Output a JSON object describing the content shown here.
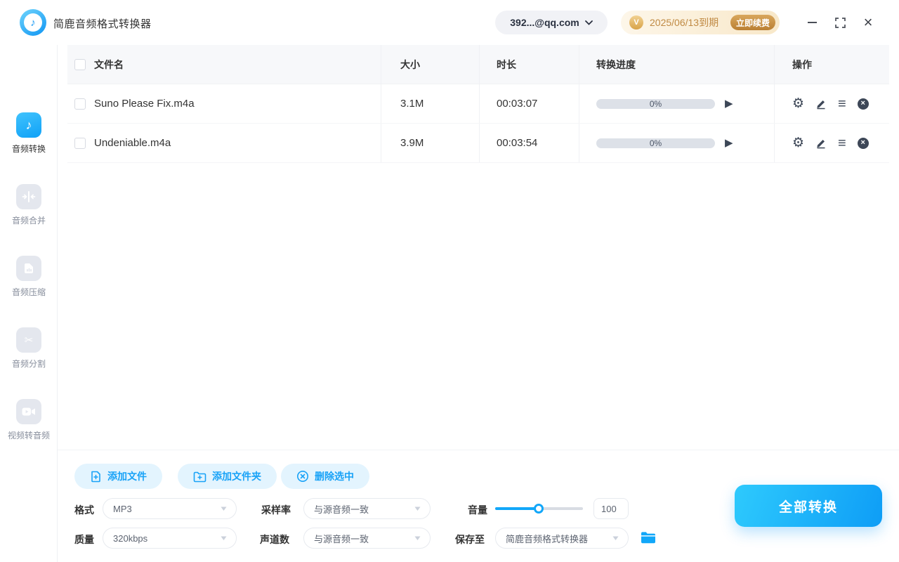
{
  "app_title": "简鹿音频格式转换器",
  "titlebar": {
    "account": "392...@qq.com",
    "vip_badge": "V",
    "vip_expiry": "2025/06/13到期",
    "renew_label": "立即续费"
  },
  "sidebar": {
    "items": [
      {
        "label": "音频转换",
        "active": true
      },
      {
        "label": "音频合并",
        "active": false
      },
      {
        "label": "音频压缩",
        "active": false
      },
      {
        "label": "音频分割",
        "active": false
      },
      {
        "label": "视频转音频",
        "active": false
      }
    ]
  },
  "table": {
    "headers": {
      "filename": "文件名",
      "size": "大小",
      "duration": "时长",
      "progress": "转换进度",
      "actions": "操作"
    },
    "rows": [
      {
        "filename": "Suno Please Fix.m4a",
        "size": "3.1M",
        "duration": "00:03:07",
        "progress": "0%"
      },
      {
        "filename": "Undeniable.m4a",
        "size": "3.9M",
        "duration": "00:03:54",
        "progress": "0%"
      }
    ]
  },
  "toolbar": {
    "add_file": "添加文件",
    "add_folder": "添加文件夹",
    "delete_selected": "删除选中"
  },
  "settings": {
    "format": {
      "label": "格式",
      "value": "MP3"
    },
    "sample_rate": {
      "label": "采样率",
      "value": "与源音频一致"
    },
    "volume": {
      "label": "音量",
      "value": "100"
    },
    "quality": {
      "label": "质量",
      "value": "320kbps"
    },
    "channels": {
      "label": "声道数",
      "value": "与源音频一致"
    },
    "save_to": {
      "label": "保存至",
      "value": "简鹿音频格式转换器"
    }
  },
  "convert_all_label": "全部转换",
  "colors": {
    "primary": "#14a5f8",
    "primary_light_bg": "#e3f4fe",
    "gold_text": "#c08a43",
    "gold_button": "#c8913f",
    "icon_dark": "#3d4757",
    "progress_bg": "#dde1e8",
    "header_bg": "#f7f8fa"
  }
}
